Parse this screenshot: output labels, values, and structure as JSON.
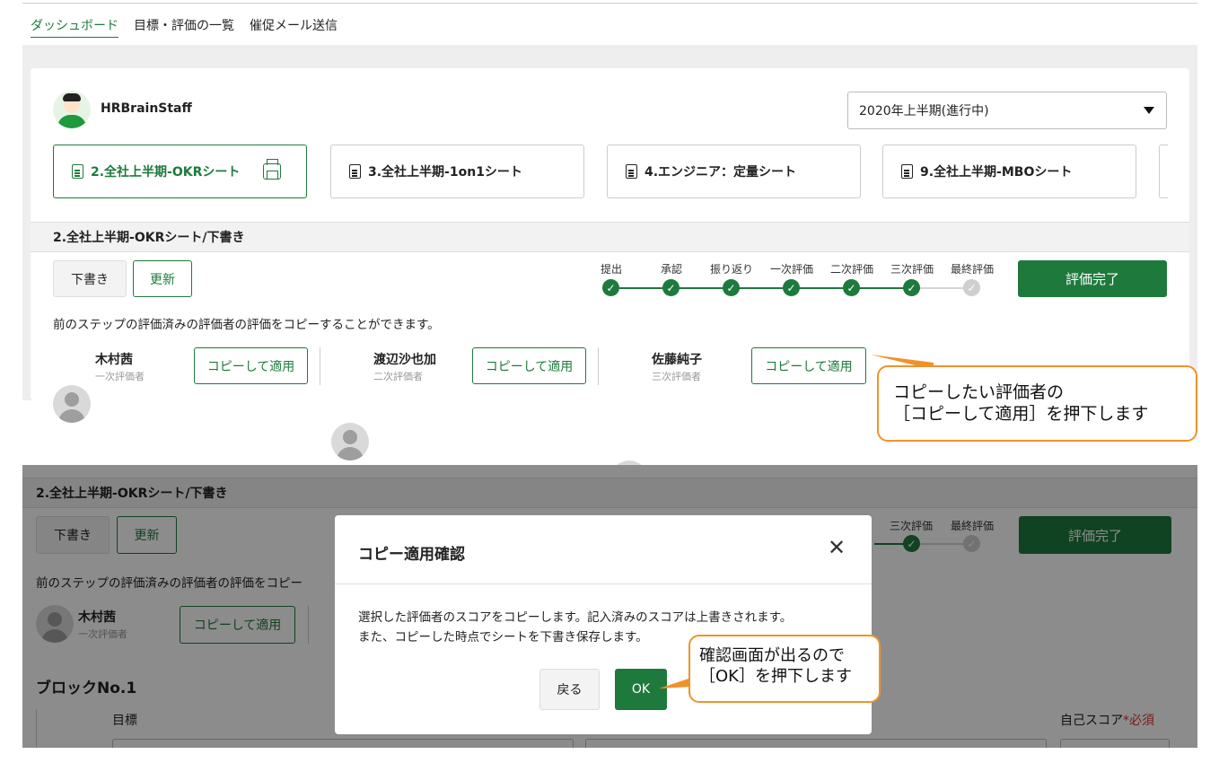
{
  "nav": {
    "items": [
      "ダッシュボード",
      "目標・評価の一覧",
      "催促メール送信"
    ]
  },
  "user": {
    "name": "HRBrainStaff"
  },
  "period_select": {
    "value": "2020年上半期(進行中)"
  },
  "sheet_tabs": [
    {
      "label": "2.全社上半期-OKRシート"
    },
    {
      "label": "3.全社上半期-1on1シート"
    },
    {
      "label": "4.エンジニア：定量シート"
    },
    {
      "label": "9.全社上半期-MBOシート"
    }
  ],
  "sheet_header": "2.全社上半期-OKRシート/下書き",
  "buttons": {
    "draft": "下書き",
    "update": "更新",
    "complete": "評価完了"
  },
  "steps": [
    "提出",
    "承認",
    "振り返り",
    "一次評価",
    "二次評価",
    "三次評価",
    "最終評価"
  ],
  "steps_completed": 6,
  "copy_info": "前のステップの評価済みの評価者の評価をコピーすることができます。",
  "evaluators": [
    {
      "name": "木村茜",
      "role": "一次評価者",
      "button": "コピーして適用"
    },
    {
      "name": "渡辺沙也加",
      "role": "二次評価者",
      "button": "コピーして適用"
    },
    {
      "name": "佐藤純子",
      "role": "三次評価者",
      "button": "コピーして適用"
    }
  ],
  "callout1": {
    "line1": "コピーしたい評価者の",
    "line2": "［コピーして適用］を押下します"
  },
  "lower": {
    "sheet_header": "2.全社上半期-OKRシート/下書き",
    "copy_info_partial": "前のステップの評価済みの評価者の評価をコピー",
    "evaluator": {
      "name": "木村茜",
      "role": "一次評価者",
      "button": "コピーして適用"
    },
    "step_labels": [
      "三次評価",
      "最終評価"
    ],
    "block_title": "ブロックNo.1",
    "goal_label": "目標",
    "self_score_label": "自己スコア",
    "required_mark": "*必須"
  },
  "modal": {
    "title": "コピー適用確認",
    "body_line1": "選択した評価者のスコアをコピーします。記入済みのスコアは上書きされます。",
    "body_line2": "また、コピーした時点でシートを下書き保存します。",
    "back_button": "戻る",
    "ok_button": "OK"
  },
  "callout2": {
    "line1": "確認画面が出るので",
    "line2": "［OK］を押下します"
  },
  "colors": {
    "accent": "#1e7a3c",
    "callout_border": "#f0922a"
  }
}
